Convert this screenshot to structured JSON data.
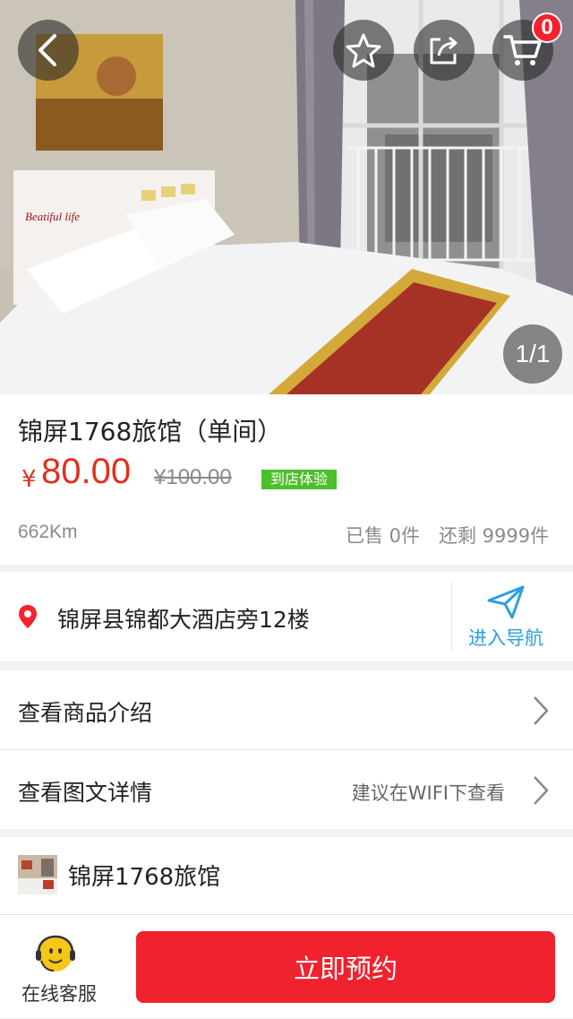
{
  "hero": {
    "cart_count": "0",
    "pager": "1/1",
    "pillow_text": "Beatiful life"
  },
  "product": {
    "title": "锦屏1768旅馆（单间）",
    "currency": "¥",
    "price": "80.00",
    "original_price": "¥100.00",
    "tag": "到店体验",
    "distance": "662Km",
    "sold": "已售 0件",
    "remaining": "还剩 9999件"
  },
  "address": {
    "text": "锦屏县锦都大酒店旁12楼",
    "nav_label": "进入导航"
  },
  "rows": {
    "intro": "查看商品介绍",
    "details": "查看图文详情",
    "details_hint": "建议在WIFI下查看"
  },
  "shop": {
    "name": "锦屏1768旅馆"
  },
  "bottom": {
    "service_label": "在线客服",
    "book_label": "立即预约"
  },
  "colors": {
    "accent": "#f0222e",
    "price": "#e0301e",
    "tag": "#4cbf2b",
    "nav": "#2d9fe0"
  }
}
